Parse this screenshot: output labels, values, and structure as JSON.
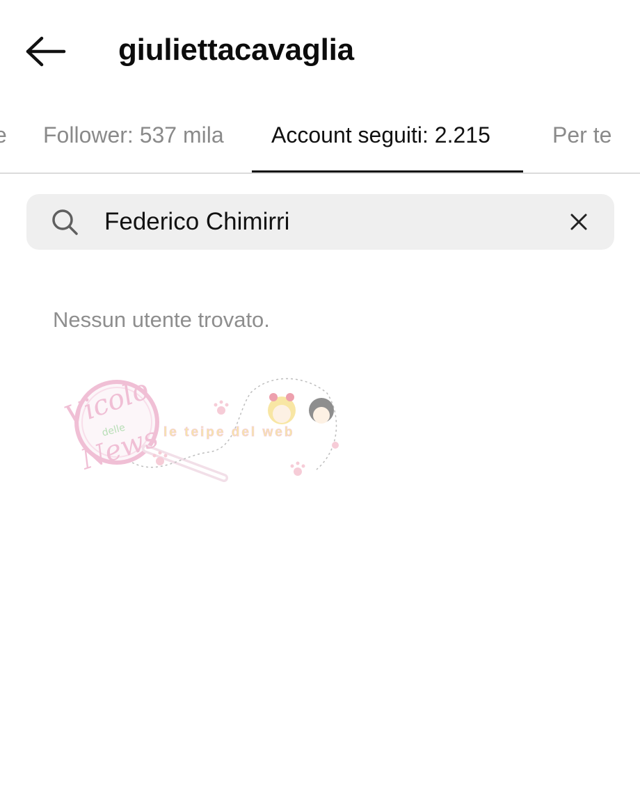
{
  "header": {
    "username": "giuliettacavaglia",
    "back_icon": "arrow-left-icon"
  },
  "tabs": [
    {
      "label": "e",
      "active": false
    },
    {
      "label": "Follower: 537 mila",
      "active": false
    },
    {
      "label": "Account seguiti: 2.215",
      "active": true
    },
    {
      "label": "Per te",
      "active": false
    }
  ],
  "search": {
    "value": "Federico Chimirri",
    "icon": "search-icon",
    "clear_icon": "close-icon"
  },
  "results": {
    "empty_message": "Nessun utente trovato."
  },
  "watermark": {
    "line1": "Vicolo",
    "line2": "delle",
    "line3": "News",
    "tagline": "le teipe del web"
  },
  "colors": {
    "text_primary": "#111111",
    "text_secondary": "#8a8a8a",
    "search_bg": "#efefef",
    "tab_border": "#dbdbdb",
    "watermark_pink": "#e48bb4",
    "watermark_yellow": "#f3d35a"
  }
}
